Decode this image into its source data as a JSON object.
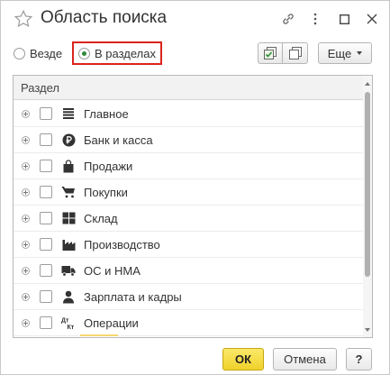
{
  "window": {
    "title": "Область поиска",
    "controls": {
      "favorite_icon": "star-icon",
      "link_icon": "link-icon",
      "more_icon": "vertical-dots-icon",
      "maximize_icon": "maximize-icon",
      "close_icon": "close-icon"
    }
  },
  "search_scope": {
    "option_everywhere": "Везде",
    "option_sections": "В разделах",
    "selected": "В разделах",
    "highlight_color": "#d9251c",
    "selected_dot_color": "#2e8b3a"
  },
  "toolbar": {
    "check_all_icon": "check-all-icon",
    "copy_icon": "copy-icon",
    "more_label": "Еще"
  },
  "table": {
    "column_header": "Раздел",
    "rows": [
      {
        "label": "Главное",
        "icon": "menu-lines-icon",
        "checked": false
      },
      {
        "label": "Банк и касса",
        "icon": "ruble-icon",
        "checked": false
      },
      {
        "label": "Продажи",
        "icon": "shopping-bag-icon",
        "checked": false
      },
      {
        "label": "Покупки",
        "icon": "cart-icon",
        "checked": false
      },
      {
        "label": "Склад",
        "icon": "warehouse-icon",
        "checked": false
      },
      {
        "label": "Производство",
        "icon": "factory-icon",
        "checked": false
      },
      {
        "label": "ОС и НМА",
        "icon": "truck-icon",
        "checked": false
      },
      {
        "label": "Зарплата и кадры",
        "icon": "person-icon",
        "checked": false
      },
      {
        "label": "Операции",
        "icon": "dt-kt-icon",
        "checked": false
      }
    ]
  },
  "footer": {
    "ok_label": "ОК",
    "cancel_label": "Отмена",
    "help_label": "?",
    "ok_color": "#f5dc3a"
  }
}
